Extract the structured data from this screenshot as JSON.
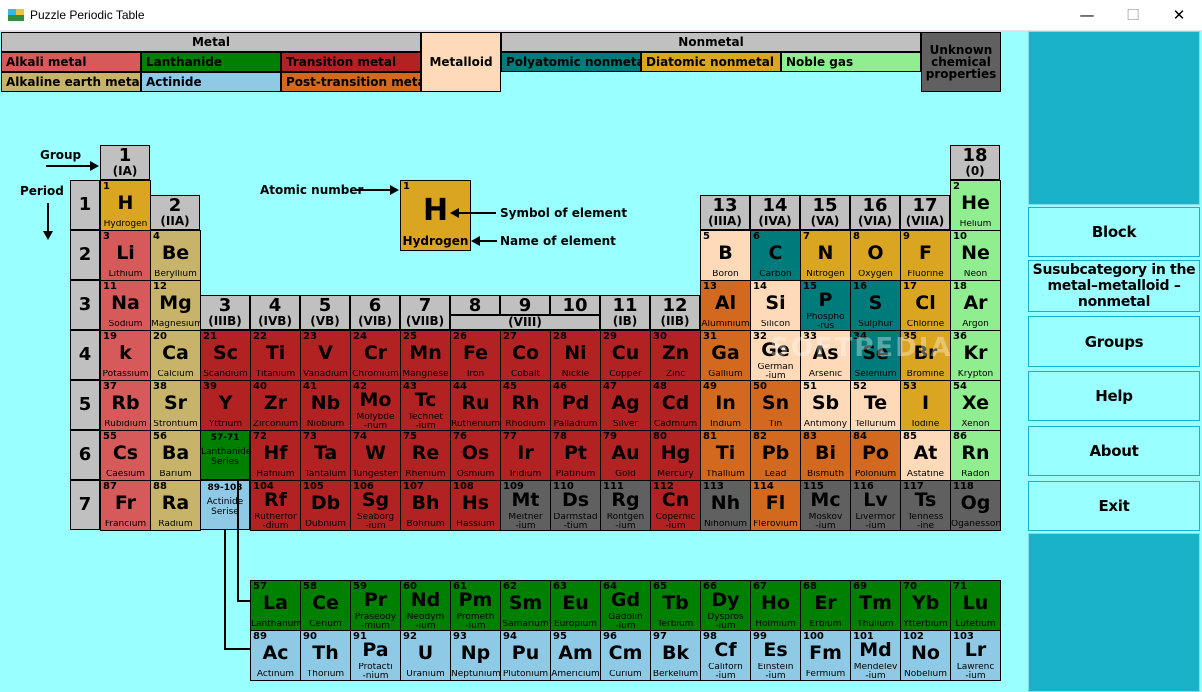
{
  "window": {
    "title": "Puzzle Periodic Table",
    "minimize": "—",
    "maximize": "☐",
    "close": "✕"
  },
  "colors": {
    "alkali": "#d65a5a",
    "alkaline": "#c7b46a",
    "transition": "#b22222",
    "post": "#d2691e",
    "lanthanide": "#008000",
    "actinide": "#8ecae6",
    "metalloid": "#ffdab9",
    "polyatomic": "#007b7b",
    "diatomic": "#daa520",
    "noble": "#90ee90",
    "unknown": "#606060",
    "metal_bar": "#c0c0c0",
    "background": "#99ffff",
    "button": "#1ab2c8"
  },
  "legend": {
    "metal": "Metal",
    "nonmetal": "Nonmetal",
    "alkali": "Alkali metal",
    "lanthanide": "Lanthanide",
    "transition": "Transition metal",
    "alkaline": "Alkaline earth metal",
    "actinide": "Actinide",
    "post": "Post-transition metal",
    "metalloid": "Metalloid",
    "polyatomic": "Polyatomic nonmetal",
    "diatomic": "Diatomic nonmetal",
    "noble": "Noble gas",
    "unknown": "Unknown\nchemical\nproperties"
  },
  "annotations": {
    "group": "Group",
    "period": "Period",
    "atomic_number": "Atomic number",
    "symbol": "Symbol of element",
    "name": "Name of element"
  },
  "key_example": {
    "number": "1",
    "symbol": "H",
    "name": "Hydrogen"
  },
  "groups": [
    {
      "n": "1",
      "r": "(IA)"
    },
    {
      "n": "2",
      "r": "(IIA)"
    },
    {
      "n": "3",
      "r": "(IIIB)"
    },
    {
      "n": "4",
      "r": "(IVB)"
    },
    {
      "n": "5",
      "r": "(VB)"
    },
    {
      "n": "6",
      "r": "(VIB)"
    },
    {
      "n": "7",
      "r": "(VIIB)"
    },
    {
      "n": "8",
      "r": ""
    },
    {
      "n": "9",
      "r": "(VIII)"
    },
    {
      "n": "10",
      "r": ""
    },
    {
      "n": "11",
      "r": "(IB)"
    },
    {
      "n": "12",
      "r": "(IIB)"
    },
    {
      "n": "13",
      "r": "(IIIA)"
    },
    {
      "n": "14",
      "r": "(IVA)"
    },
    {
      "n": "15",
      "r": "(VA)"
    },
    {
      "n": "16",
      "r": "(VIA)"
    },
    {
      "n": "17",
      "r": "(VIIA)"
    },
    {
      "n": "18",
      "r": "(0)"
    }
  ],
  "periods": [
    "1",
    "2",
    "3",
    "4",
    "5",
    "6",
    "7"
  ],
  "special": {
    "lan_range": "57-71",
    "lan_label": "Lanthanide\nSeries",
    "act_range": "89-103",
    "act_label": "Actinide\nSerise"
  },
  "elements": [
    [
      "1",
      "H",
      "Hydrogen",
      "diatomic"
    ],
    [
      "2",
      "He",
      "Helium",
      "noble"
    ],
    [
      "3",
      "Li",
      "Lithium",
      "alkali"
    ],
    [
      "4",
      "Be",
      "Beryllium",
      "alkaline"
    ],
    [
      "5",
      "B",
      "Boron",
      "metalloid"
    ],
    [
      "6",
      "C",
      "Carbon",
      "polyatomic"
    ],
    [
      "7",
      "N",
      "Nitrogen",
      "diatomic"
    ],
    [
      "8",
      "O",
      "Oxygen",
      "diatomic"
    ],
    [
      "9",
      "F",
      "Fluorine",
      "diatomic"
    ],
    [
      "10",
      "Ne",
      "Neon",
      "noble"
    ],
    [
      "11",
      "Na",
      "Sodium",
      "alkali"
    ],
    [
      "12",
      "Mg",
      "Magnesium",
      "alkaline"
    ],
    [
      "13",
      "Al",
      "Aluminium",
      "post"
    ],
    [
      "14",
      "Si",
      "Silicon",
      "metalloid"
    ],
    [
      "15",
      "P",
      "Phospho\n-rus",
      "polyatomic"
    ],
    [
      "16",
      "S",
      "Sulphur",
      "polyatomic"
    ],
    [
      "17",
      "Cl",
      "Chlorine",
      "diatomic"
    ],
    [
      "18",
      "Ar",
      "Argon",
      "noble"
    ],
    [
      "19",
      "k",
      "Potassium",
      "alkali"
    ],
    [
      "20",
      "Ca",
      "Calcium",
      "alkaline"
    ],
    [
      "21",
      "Sc",
      "Scandium",
      "transition"
    ],
    [
      "22",
      "Ti",
      "Titanium",
      "transition"
    ],
    [
      "23",
      "V",
      "Vanadium",
      "transition"
    ],
    [
      "24",
      "Cr",
      "Chromium",
      "transition"
    ],
    [
      "25",
      "Mn",
      "Mangnese",
      "transition"
    ],
    [
      "26",
      "Fe",
      "Iron",
      "transition"
    ],
    [
      "27",
      "Co",
      "Cobalt",
      "transition"
    ],
    [
      "28",
      "Ni",
      "Nickle",
      "transition"
    ],
    [
      "29",
      "Cu",
      "Copper",
      "transition"
    ],
    [
      "30",
      "Zn",
      "Zinc",
      "transition"
    ],
    [
      "31",
      "Ga",
      "Gallium",
      "post"
    ],
    [
      "32",
      "Ge",
      "German\n-ium",
      "metalloid"
    ],
    [
      "33",
      "As",
      "Arsenic",
      "metalloid"
    ],
    [
      "34",
      "Se",
      "Selenium",
      "polyatomic"
    ],
    [
      "35",
      "Br",
      "Bromine",
      "diatomic"
    ],
    [
      "36",
      "Kr",
      "Krypton",
      "noble"
    ],
    [
      "37",
      "Rb",
      "Rubidium",
      "alkali"
    ],
    [
      "38",
      "Sr",
      "Strontium",
      "alkaline"
    ],
    [
      "39",
      "Y",
      "Yttrium",
      "transition"
    ],
    [
      "40",
      "Zr",
      "Zirconium",
      "transition"
    ],
    [
      "41",
      "Nb",
      "Niobium",
      "transition"
    ],
    [
      "42",
      "Mo",
      "Molybde\n-num",
      "transition"
    ],
    [
      "43",
      "Tc",
      "Technet\n-ium",
      "transition"
    ],
    [
      "44",
      "Ru",
      "Ruthenium",
      "transition"
    ],
    [
      "45",
      "Rh",
      "Rhodium",
      "transition"
    ],
    [
      "46",
      "Pd",
      "Palladium",
      "transition"
    ],
    [
      "47",
      "Ag",
      "Silver",
      "transition"
    ],
    [
      "48",
      "Cd",
      "Cadmium",
      "transition"
    ],
    [
      "49",
      "In",
      "Indium",
      "post"
    ],
    [
      "50",
      "Sn",
      "Tin",
      "post"
    ],
    [
      "51",
      "Sb",
      "Antimony",
      "metalloid"
    ],
    [
      "52",
      "Te",
      "Tellurium",
      "metalloid"
    ],
    [
      "53",
      "I",
      "Iodine",
      "diatomic"
    ],
    [
      "54",
      "Xe",
      "Xenon",
      "noble"
    ],
    [
      "55",
      "Cs",
      "Caesium",
      "alkali"
    ],
    [
      "56",
      "Ba",
      "Barium",
      "alkaline"
    ],
    [
      "72",
      "Hf",
      "Hafnium",
      "transition"
    ],
    [
      "73",
      "Ta",
      "Tantalum",
      "transition"
    ],
    [
      "74",
      "W",
      "Tungesten",
      "transition"
    ],
    [
      "75",
      "Re",
      "Rhenium",
      "transition"
    ],
    [
      "76",
      "Os",
      "Osmium",
      "transition"
    ],
    [
      "77",
      "Ir",
      "Iridium",
      "transition"
    ],
    [
      "78",
      "Pt",
      "Platinum",
      "transition"
    ],
    [
      "79",
      "Au",
      "Gold",
      "transition"
    ],
    [
      "80",
      "Hg",
      "Mercury",
      "transition"
    ],
    [
      "81",
      "Ti",
      "Thallium",
      "post"
    ],
    [
      "82",
      "Pb",
      "Lead",
      "post"
    ],
    [
      "83",
      "Bi",
      "Bismuth",
      "post"
    ],
    [
      "84",
      "Po",
      "Polonium",
      "post"
    ],
    [
      "85",
      "At",
      "Astatine",
      "metalloid"
    ],
    [
      "86",
      "Rn",
      "Radon",
      "noble"
    ],
    [
      "87",
      "Fr",
      "Francium",
      "alkali"
    ],
    [
      "88",
      "Ra",
      "Radium",
      "alkaline"
    ],
    [
      "104",
      "Rf",
      "Rutherfor\n-dium",
      "transition"
    ],
    [
      "105",
      "Db",
      "Dubnium",
      "transition"
    ],
    [
      "106",
      "Sg",
      "Seaborg\n-ium",
      "transition"
    ],
    [
      "107",
      "Bh",
      "Bohrium",
      "transition"
    ],
    [
      "108",
      "Hs",
      "Hassium",
      "transition"
    ],
    [
      "109",
      "Mt",
      "Meitner\n-ium",
      "unknown"
    ],
    [
      "110",
      "Ds",
      "Darmstad\n-tium",
      "unknown"
    ],
    [
      "111",
      "Rg",
      "Rontgen\n-ium",
      "unknown"
    ],
    [
      "112",
      "Cn",
      "Copernic\n-ium",
      "transition"
    ],
    [
      "113",
      "Nh",
      "Nihonium",
      "unknown"
    ],
    [
      "114",
      "Fl",
      "Flerovium",
      "post"
    ],
    [
      "115",
      "Mc",
      "Moskov\n-ium",
      "unknown"
    ],
    [
      "116",
      "Lv",
      "Livermor\n-ium",
      "unknown"
    ],
    [
      "117",
      "Ts",
      "Tenness\n-ine",
      "unknown"
    ],
    [
      "118",
      "Og",
      "Oganesson",
      "unknown"
    ],
    [
      "57",
      "La",
      "Lanthanum",
      "lanthanide"
    ],
    [
      "58",
      "Ce",
      "Cerium",
      "lanthanide"
    ],
    [
      "59",
      "Pr",
      "Praseody\n-mium",
      "lanthanide"
    ],
    [
      "60",
      "Nd",
      "Neodym\n-ium",
      "lanthanide"
    ],
    [
      "61",
      "Pm",
      "Prometh\n-ium",
      "lanthanide"
    ],
    [
      "62",
      "Sm",
      "Samarium",
      "lanthanide"
    ],
    [
      "63",
      "Eu",
      "Europium",
      "lanthanide"
    ],
    [
      "64",
      "Gd",
      "Gadolin\n-ium",
      "lanthanide"
    ],
    [
      "65",
      "Tb",
      "Terbium",
      "lanthanide"
    ],
    [
      "66",
      "Dy",
      "Dyspros\n-ium",
      "lanthanide"
    ],
    [
      "67",
      "Ho",
      "Holmium",
      "lanthanide"
    ],
    [
      "68",
      "Er",
      "Erbium",
      "lanthanide"
    ],
    [
      "69",
      "Tm",
      "Thulium",
      "lanthanide"
    ],
    [
      "70",
      "Yb",
      "Ytterbium",
      "lanthanide"
    ],
    [
      "71",
      "Lu",
      "Lutetium",
      "lanthanide"
    ],
    [
      "89",
      "Ac",
      "Actinum",
      "actinide"
    ],
    [
      "90",
      "Th",
      "Thorium",
      "actinide"
    ],
    [
      "91",
      "Pa",
      "Protacti\n-nium",
      "actinide"
    ],
    [
      "92",
      "U",
      "Uranium",
      "actinide"
    ],
    [
      "93",
      "Np",
      "Neptunium",
      "actinide"
    ],
    [
      "94",
      "Pu",
      "Plutonium",
      "actinide"
    ],
    [
      "95",
      "Am",
      "Americium",
      "actinide"
    ],
    [
      "96",
      "Cm",
      "Curium",
      "actinide"
    ],
    [
      "97",
      "Bk",
      "Berkelium",
      "actinide"
    ],
    [
      "98",
      "Cf",
      "Californ\n-ium",
      "actinide"
    ],
    [
      "99",
      "Es",
      "Einstein\n-ium",
      "actinide"
    ],
    [
      "100",
      "Fm",
      "Fermium",
      "actinide"
    ],
    [
      "101",
      "Md",
      "Mendelev\n-ium",
      "actinide"
    ],
    [
      "102",
      "No",
      "Nobelium",
      "actinide"
    ],
    [
      "103",
      "Lr",
      "Lawrenc\n-ium",
      "actinide"
    ]
  ],
  "sidebar": {
    "block": "Block",
    "subcategory": "Susubcategory in the metal–metalloid –nonmetal",
    "groups": "Groups",
    "help": "Help",
    "about": "About",
    "exit": "Exit"
  },
  "watermark": "SOFTPEDIA"
}
